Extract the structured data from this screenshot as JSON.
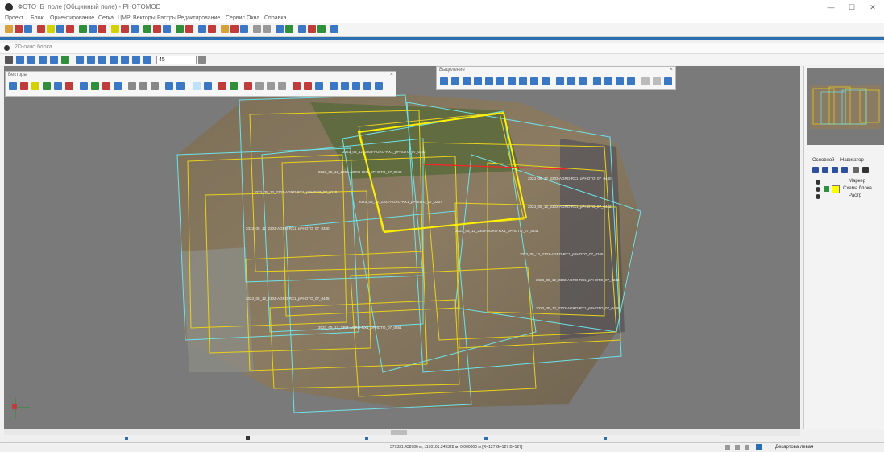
{
  "window": {
    "title": "ФОТО_Б_поле (Общинный поле) - PHOTOMOD",
    "min": "—",
    "max": "☐",
    "close": "✕"
  },
  "menu": [
    "Проект",
    "Блок",
    "Ориентирование",
    "Сетка",
    "ЦМР",
    "Векторы",
    "Растры",
    "Редактирование",
    "Сервис",
    "Окна",
    "Справка"
  ],
  "child_window": {
    "title": "2D-окно блока"
  },
  "view_toolbar": {
    "zoom_value": "45"
  },
  "panels": {
    "vectors": {
      "title": "Векторы"
    },
    "selection": {
      "title": "Выделение"
    }
  },
  "right_panel": {
    "tabs": [
      "Основной",
      "Навигатор"
    ],
    "layers": [
      {
        "label": "Маркер"
      },
      {
        "label": "Схема блока"
      },
      {
        "label": "Растр"
      }
    ]
  },
  "overlay_labels": [
    "2023_05_12_2303-AGRO-RX1_pPHOTO_07_0143",
    "2023_05_12_2303-AGRO-RX1_pPHOTO_07_0240",
    "2023_05_12_2303-AGRO-RX1_pPHOTO_07_0440",
    "2023_05_12_2303-AGRO-RX1_pPHOTO_07_0118",
    "2023_05_12_2303-AGRO-RX1_pPHOTO_07_0237",
    "2023_05_12_2303-AGRO-RX1_pPHOTO_07_0442",
    "2023_05_12_2303-AGRO-RX1_pPHOTO_07_0340",
    "2023_05_12_2303-AGRO-RX1_pPHOTO_07_0444",
    "2023_05_12_2303-AGRO-RX1_pPHOTO_07_0346",
    "2023_05_12_2303-AGRO-RX1_pPHOTO_07_0349",
    "2023_05_12_2303-AGRO-RX1_pPHOTO_07_0436",
    "2023_05_12_2303-AGRO-RX1_pPHOTO_07_0435",
    "2023_05_12_2303-AGRO-RX1_pPHOTO_07_0351"
  ],
  "status": {
    "coords": "377331.438786 м; 1170101.249328 м; 0.000000 м   [R=127 G=127 B=127]",
    "mode": "Декартова левая"
  },
  "colors": {
    "canvas_bg": "#7a7a7a",
    "frame_yellow": "#e8d21c",
    "frame_cyan": "#6fe2e8",
    "accent_blue": "#2c6fb0",
    "red_line": "#ff2020"
  }
}
